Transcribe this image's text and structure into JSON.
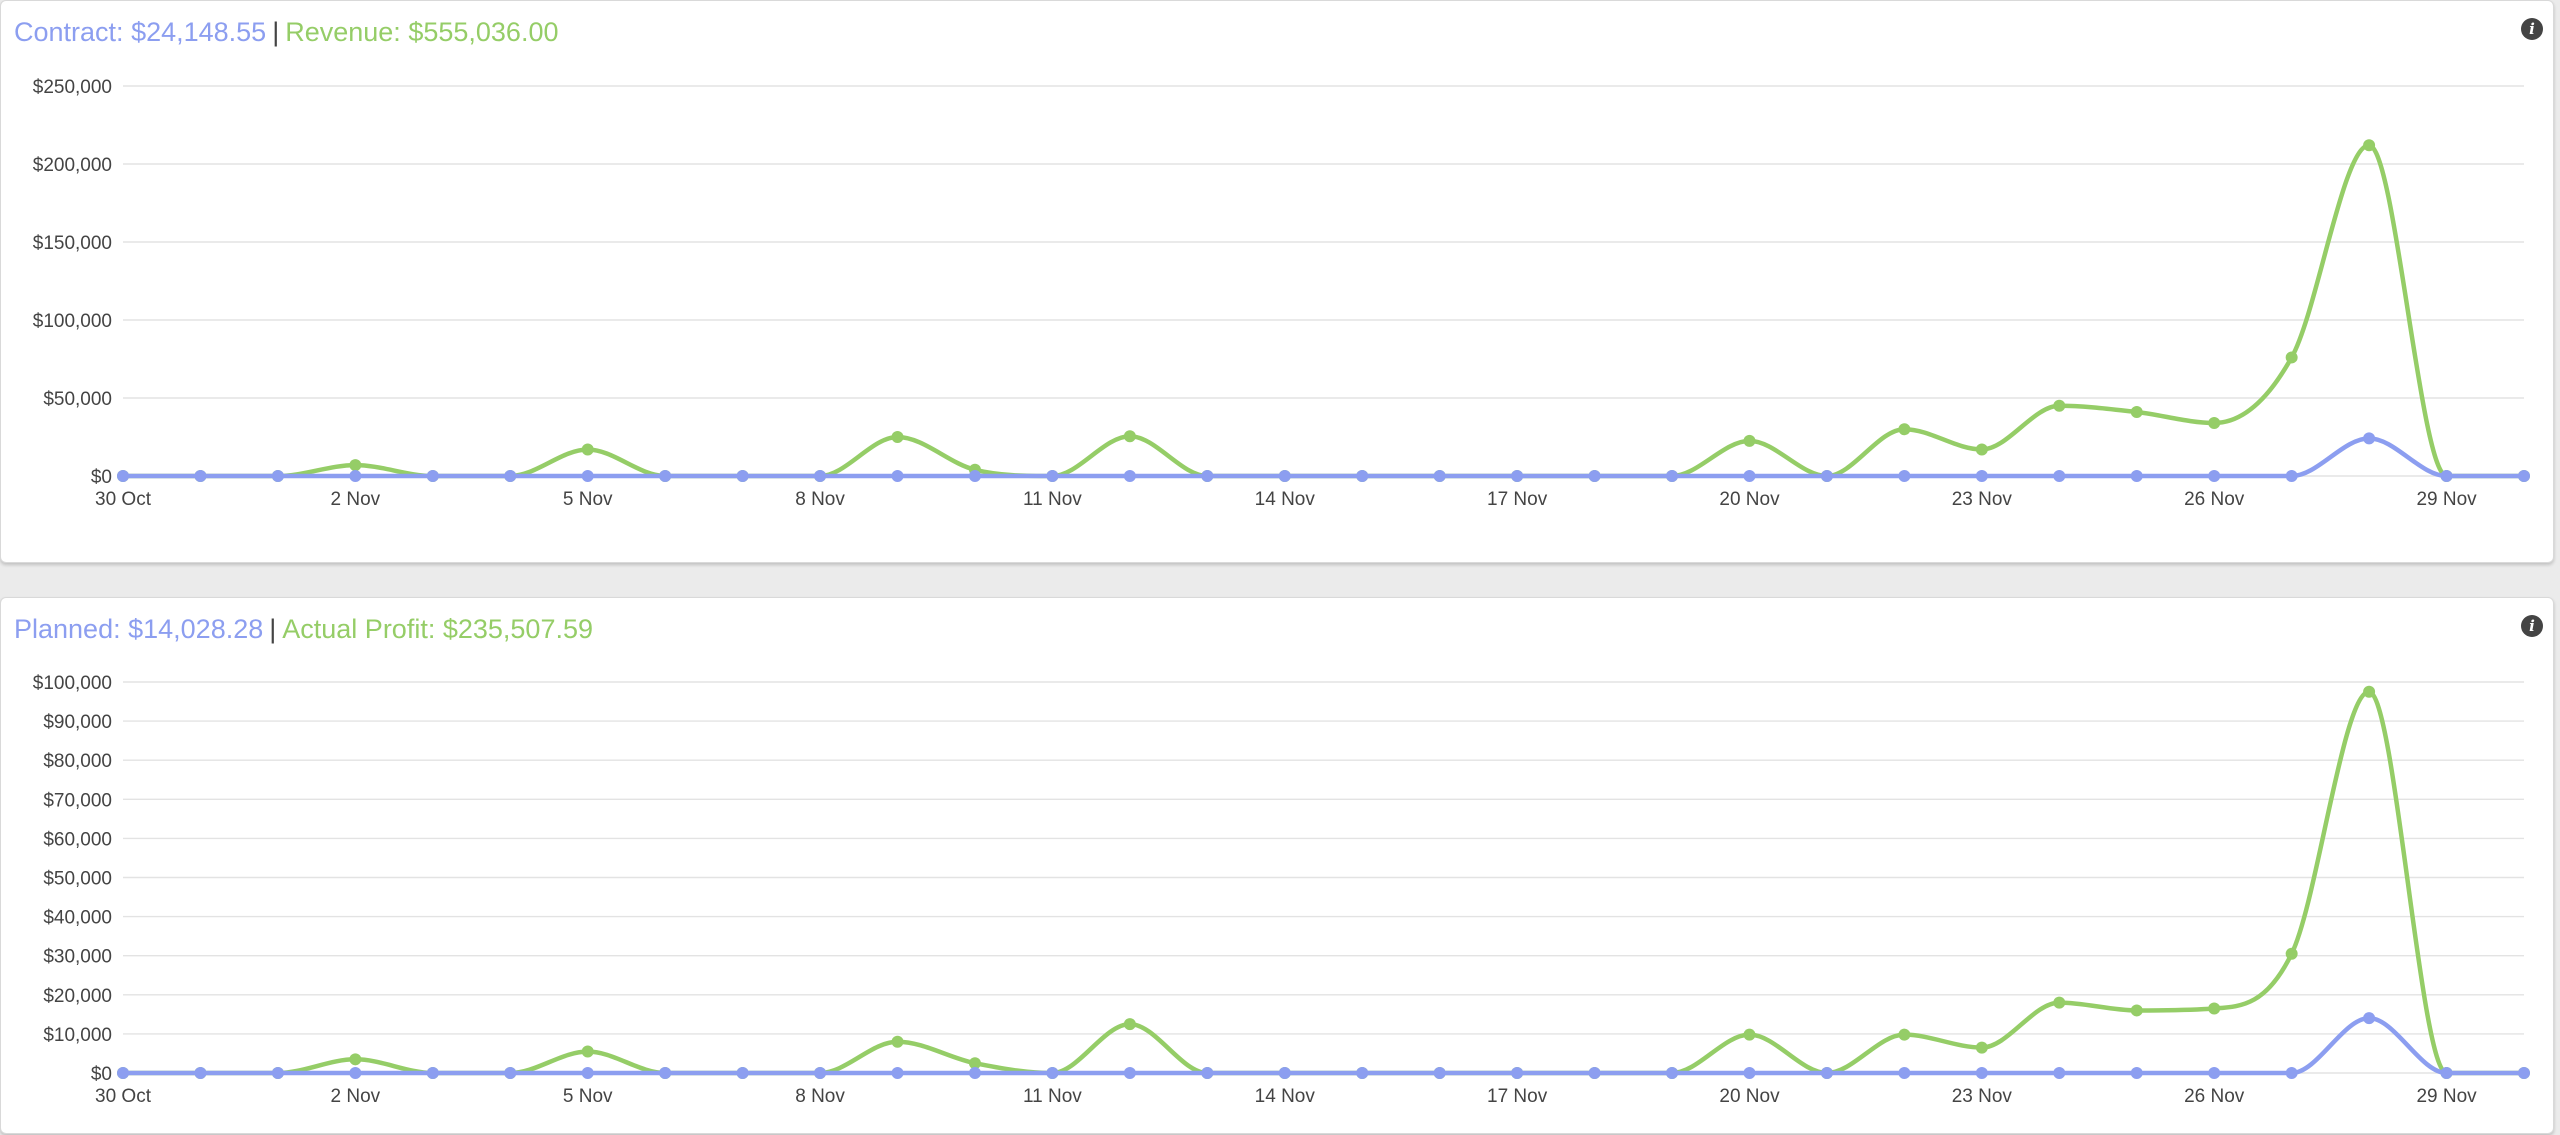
{
  "colors": {
    "blue": "#8c9ef0",
    "green": "#95cd67",
    "grid": "#e3e3e3",
    "text": "#444444",
    "separator": "#444444"
  },
  "panels": [
    {
      "header": {
        "label_a": "Contract:",
        "value_a": "$24,148.55",
        "separator": "|",
        "label_b": "Revenue:",
        "value_b": "$555,036.00"
      },
      "info_icon": "info-circle-icon"
    },
    {
      "header": {
        "label_a": "Planned:",
        "value_a": "$14,028.28",
        "separator": "|",
        "label_b": "Actual Profit:",
        "value_b": "$235,507.59"
      },
      "info_icon": "info-circle-icon"
    }
  ],
  "chart_data": [
    {
      "type": "line",
      "smooth": true,
      "x": [
        "30 Oct",
        "31 Oct",
        "1 Nov",
        "2 Nov",
        "3 Nov",
        "4 Nov",
        "5 Nov",
        "6 Nov",
        "7 Nov",
        "8 Nov",
        "9 Nov",
        "10 Nov",
        "11 Nov",
        "12 Nov",
        "13 Nov",
        "14 Nov",
        "15 Nov",
        "16 Nov",
        "17 Nov",
        "18 Nov",
        "19 Nov",
        "20 Nov",
        "21 Nov",
        "22 Nov",
        "23 Nov",
        "24 Nov",
        "25 Nov",
        "26 Nov",
        "27 Nov",
        "28 Nov",
        "29 Nov",
        "30 Nov"
      ],
      "x_tick_labels": [
        "30 Oct",
        "2 Nov",
        "5 Nov",
        "8 Nov",
        "11 Nov",
        "14 Nov",
        "17 Nov",
        "20 Nov",
        "23 Nov",
        "26 Nov",
        "29 Nov"
      ],
      "x_tick_every": 3,
      "y_tick_labels": [
        "$0",
        "$50,000",
        "$100,000",
        "$150,000",
        "$200,000",
        "$250,000"
      ],
      "ylim": [
        0,
        250000
      ],
      "grid": true,
      "series": [
        {
          "name": "Revenue",
          "color": "#95cd67",
          "values": [
            0,
            0,
            0,
            7000,
            0,
            0,
            17000,
            0,
            0,
            0,
            25000,
            4000,
            0,
            25500,
            0,
            0,
            0,
            0,
            0,
            0,
            0,
            22500,
            0,
            30000,
            17000,
            45000,
            41000,
            34000,
            76000,
            212000,
            0,
            0
          ]
        },
        {
          "name": "Contract",
          "color": "#8c9ef0",
          "values": [
            0,
            0,
            0,
            0,
            0,
            0,
            0,
            0,
            0,
            0,
            0,
            0,
            0,
            0,
            0,
            0,
            0,
            0,
            0,
            0,
            0,
            0,
            0,
            0,
            0,
            0,
            0,
            0,
            0,
            24148.55,
            0,
            0
          ]
        }
      ]
    },
    {
      "type": "line",
      "smooth": true,
      "x": [
        "30 Oct",
        "31 Oct",
        "1 Nov",
        "2 Nov",
        "3 Nov",
        "4 Nov",
        "5 Nov",
        "6 Nov",
        "7 Nov",
        "8 Nov",
        "9 Nov",
        "10 Nov",
        "11 Nov",
        "12 Nov",
        "13 Nov",
        "14 Nov",
        "15 Nov",
        "16 Nov",
        "17 Nov",
        "18 Nov",
        "19 Nov",
        "20 Nov",
        "21 Nov",
        "22 Nov",
        "23 Nov",
        "24 Nov",
        "25 Nov",
        "26 Nov",
        "27 Nov",
        "28 Nov",
        "29 Nov",
        "30 Nov"
      ],
      "x_tick_labels": [
        "30 Oct",
        "2 Nov",
        "5 Nov",
        "8 Nov",
        "11 Nov",
        "14 Nov",
        "17 Nov",
        "20 Nov",
        "23 Nov",
        "26 Nov",
        "29 Nov"
      ],
      "x_tick_every": 3,
      "y_tick_labels": [
        "$0",
        "$10,000",
        "$20,000",
        "$30,000",
        "$40,000",
        "$50,000",
        "$60,000",
        "$70,000",
        "$80,000",
        "$90,000",
        "$100,000"
      ],
      "ylim": [
        0,
        100000
      ],
      "grid": true,
      "series": [
        {
          "name": "Actual Profit",
          "color": "#95cd67",
          "values": [
            0,
            0,
            0,
            3500,
            0,
            0,
            5500,
            0,
            0,
            0,
            8000,
            2500,
            0,
            12500,
            0,
            0,
            0,
            0,
            0,
            0,
            0,
            9800,
            0,
            9800,
            6500,
            18000,
            16000,
            16500,
            30500,
            97500,
            0,
            0
          ]
        },
        {
          "name": "Planned",
          "color": "#8c9ef0",
          "values": [
            0,
            0,
            0,
            0,
            0,
            0,
            0,
            0,
            0,
            0,
            0,
            0,
            0,
            0,
            0,
            0,
            0,
            0,
            0,
            0,
            0,
            0,
            0,
            0,
            0,
            0,
            0,
            0,
            0,
            14028.28,
            0,
            0
          ]
        }
      ]
    }
  ]
}
